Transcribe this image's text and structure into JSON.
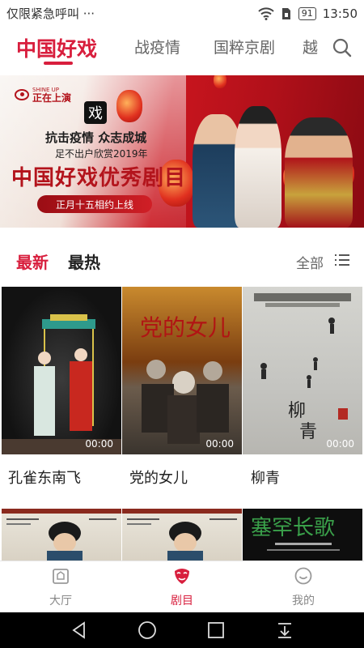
{
  "status_bar": {
    "left_text": "仅限紧急呼叫 ···",
    "battery": "91",
    "time": "13:50"
  },
  "top_tabs": [
    {
      "label": "中国好戏",
      "active": true
    },
    {
      "label": "战疫情",
      "active": false
    },
    {
      "label": "国粹京剧",
      "active": false
    },
    {
      "label": "越",
      "active": false
    }
  ],
  "banner": {
    "logo_en": "SHINE UP",
    "logo_cn": "正在上演",
    "line1": "抗击疫情 众志成城",
    "line2": "足不出户欣赏2019年",
    "title": "中国好戏优秀剧目",
    "pill": "正月十五相约上线"
  },
  "section": {
    "tabs": [
      {
        "label": "最新",
        "active": true
      },
      {
        "label": "最热",
        "active": false
      }
    ],
    "all_label": "全部"
  },
  "works": [
    {
      "title": "孔雀东南飞",
      "duration": "00:00"
    },
    {
      "title": "党的女儿",
      "duration": "00:00"
    },
    {
      "title": "柳青",
      "duration": "00:00"
    }
  ],
  "bottom_nav": [
    {
      "label": "大厅",
      "icon": "hall-icon",
      "active": false
    },
    {
      "label": "剧目",
      "icon": "opera-mask-icon",
      "active": true
    },
    {
      "label": "我的",
      "icon": "smiley-icon",
      "active": false
    }
  ],
  "colors": {
    "accent": "#d81e3d",
    "banner_red": "#b3141c"
  }
}
